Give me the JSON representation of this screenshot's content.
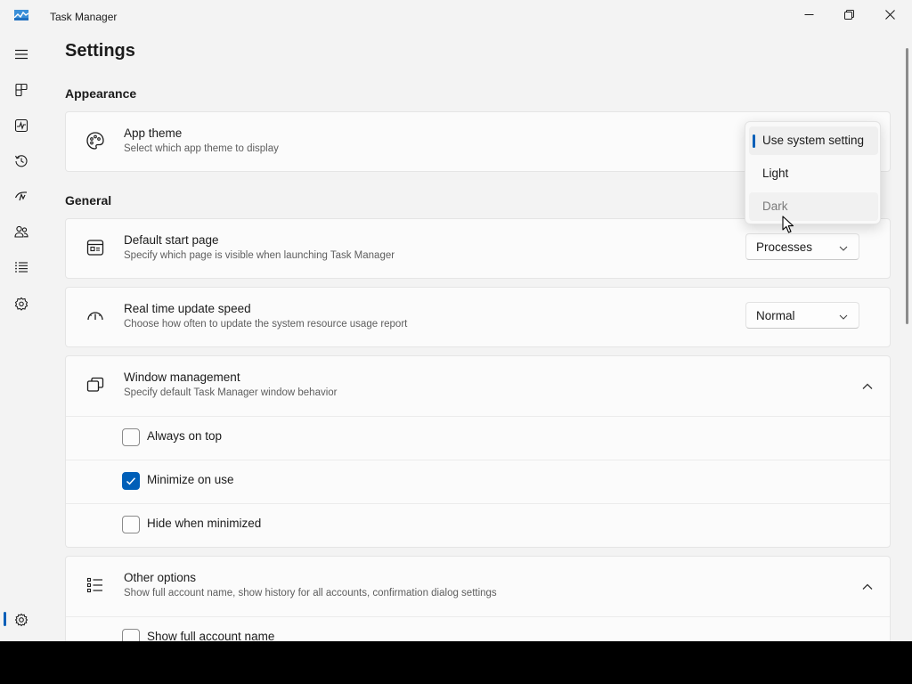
{
  "window": {
    "title": "Task Manager",
    "controls": {
      "minimize": "minimize-icon",
      "maximize": "restore-icon",
      "close": "close-icon"
    }
  },
  "nav": {
    "items": [
      {
        "name": "menu",
        "icon": "hamburger-icon"
      },
      {
        "name": "processes",
        "icon": "processes-icon"
      },
      {
        "name": "performance",
        "icon": "performance-icon"
      },
      {
        "name": "app-history",
        "icon": "history-icon"
      },
      {
        "name": "startup-apps",
        "icon": "startup-icon"
      },
      {
        "name": "users",
        "icon": "users-icon"
      },
      {
        "name": "details",
        "icon": "details-icon"
      },
      {
        "name": "services",
        "icon": "services-icon"
      },
      {
        "name": "settings",
        "icon": "gear-icon",
        "selected": true
      }
    ]
  },
  "page": {
    "title": "Settings",
    "appearance_heading": "Appearance",
    "general_heading": "General"
  },
  "app_theme": {
    "title": "App theme",
    "desc": "Select which app theme to display",
    "options": [
      "Use system setting",
      "Light",
      "Dark"
    ],
    "selected": "Use system setting",
    "hovered": "Dark"
  },
  "default_start_page": {
    "title": "Default start page",
    "desc": "Specify which page is visible when launching Task Manager",
    "value": "Processes"
  },
  "update_speed": {
    "title": "Real time update speed",
    "desc": "Choose how often to update the system resource usage report",
    "value": "Normal"
  },
  "window_management": {
    "title": "Window management",
    "desc": "Specify default Task Manager window behavior",
    "options": [
      {
        "label": "Always on top",
        "checked": false
      },
      {
        "label": "Minimize on use",
        "checked": true
      },
      {
        "label": "Hide when minimized",
        "checked": false
      }
    ]
  },
  "other_options": {
    "title": "Other options",
    "desc": "Show full account name, show history for all accounts, confirmation dialog settings",
    "options": [
      {
        "label": "Show full account name",
        "checked": false
      }
    ]
  },
  "colors": {
    "accent": "#005fb8",
    "background": "#f3f3f3",
    "card": "#fbfbfb"
  }
}
